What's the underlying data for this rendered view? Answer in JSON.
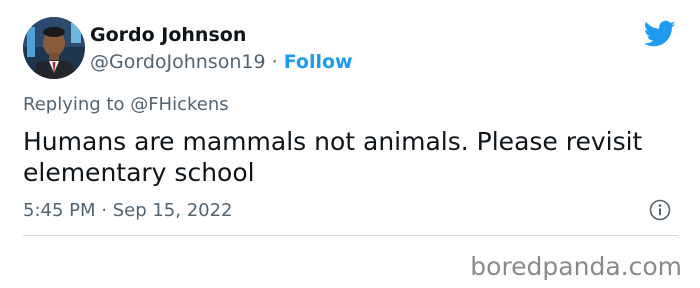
{
  "author": {
    "name": "Gordo Johnson",
    "handle": "@GordoJohnson19",
    "separator": " · ",
    "follow_label": "Follow",
    "avatar_icon": "avatar-photo"
  },
  "reply": {
    "prefix": "Replying to ",
    "target": "@FHickens"
  },
  "tweet": {
    "text": "Humans are mammals not animals. Please revisit elementary school",
    "timestamp": "5:45 PM · Sep 15, 2022"
  },
  "icons": {
    "brand": "twitter-bird-icon",
    "info": "info-icon"
  },
  "watermark": {
    "text": "boredpanda.com"
  },
  "colors": {
    "accent": "#1d9bf0",
    "secondary_text": "#536471",
    "primary_text": "#0f1419",
    "divider": "#cfd9de",
    "watermark": "#8a8a8a"
  }
}
